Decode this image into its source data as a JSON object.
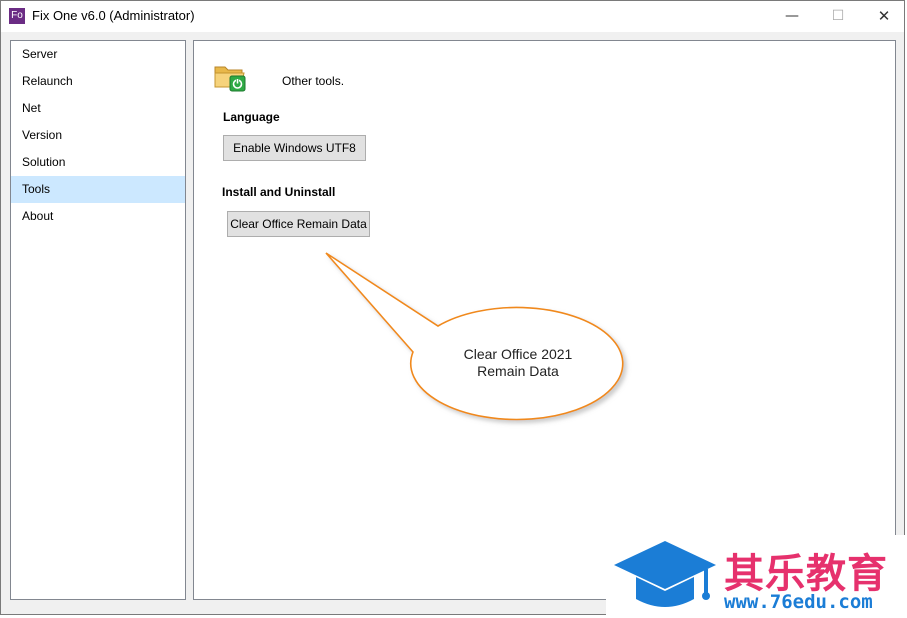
{
  "window": {
    "icon_text": "Fo",
    "title": "Fix One v6.0 (Administrator)",
    "controls": {
      "minimize": "—",
      "maximize": "☐",
      "close": "✕"
    }
  },
  "sidebar": {
    "items": [
      {
        "label": "Server",
        "selected": false
      },
      {
        "label": "Relaunch",
        "selected": false
      },
      {
        "label": "Net",
        "selected": false
      },
      {
        "label": "Version",
        "selected": false
      },
      {
        "label": "Solution",
        "selected": false
      },
      {
        "label": "Tools",
        "selected": true
      },
      {
        "label": "About",
        "selected": false
      }
    ]
  },
  "main": {
    "header_icon": "folder-power-icon",
    "header_text": "Other tools.",
    "language_label": "Language",
    "utf8_button": "Enable Windows UTF8",
    "install_label": "Install and Uninstall",
    "clear_button": "Clear Office Remain Data"
  },
  "callout": {
    "line1": "Clear Office 2021",
    "line2": "Remain Data",
    "border_color": "#f0891c"
  },
  "watermark": {
    "logo_icon": "graduation-cap-icon",
    "chinese_text": "其乐教育",
    "url": "www.76edu.com",
    "cn_color": "#e6316d",
    "url_color": "#1b7dd6"
  }
}
